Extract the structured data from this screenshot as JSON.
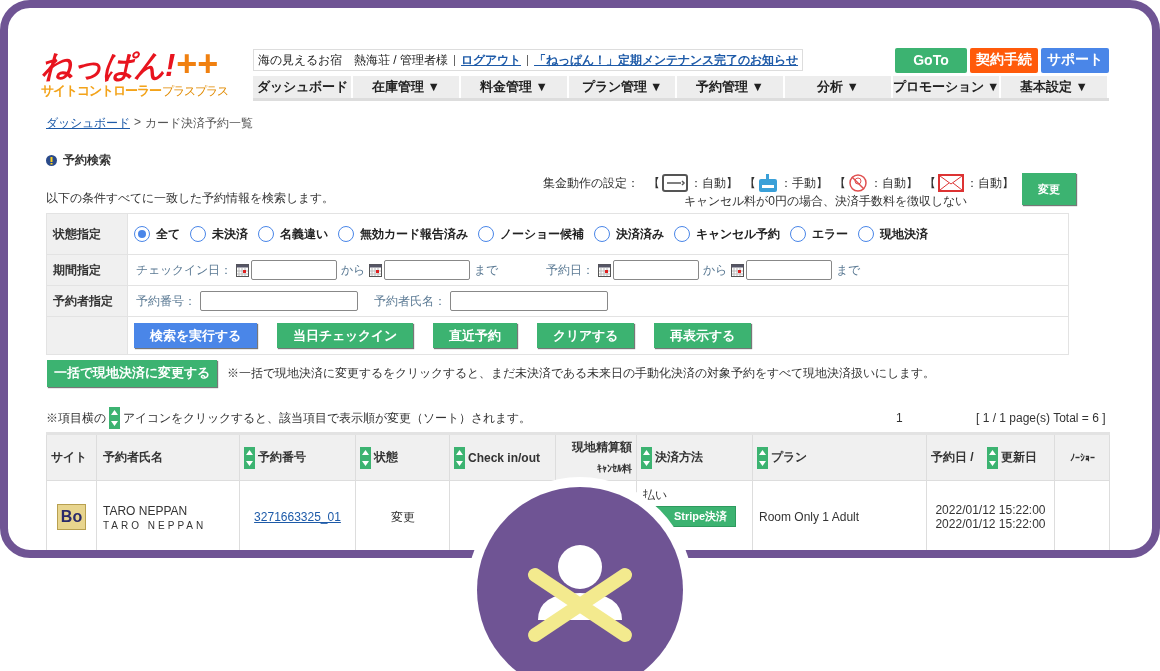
{
  "logo": {
    "main": "ねっぱん!",
    "plus": "++",
    "sub": "サイトコントローラー",
    "sub_small": "プラスプラス"
  },
  "topbar": {
    "hotel": "海の見えるお宿　熱海荘 / 管理者様",
    "links": [
      "ログアウト",
      "「ねっぱん！」定期メンテナンス完了のお知らせ"
    ]
  },
  "top_buttons": [
    {
      "label": "GoTo",
      "color": "#3cb371"
    },
    {
      "label": "契約手続",
      "color": "#ff5a0a"
    },
    {
      "label": "サポート",
      "color": "#4a86e8"
    }
  ],
  "nav": [
    "ダッシュボード",
    "在庫管理 ▼",
    "料金管理 ▼",
    "プラン管理 ▼",
    "予約管理 ▼",
    "分析 ▼",
    "プロモーション ▼",
    "基本設定 ▼"
  ],
  "breadcrumb": {
    "link": "ダッシュボード",
    "separator": ">",
    "current": "カード決済予約一覧"
  },
  "section_title": "予約検索",
  "collection": {
    "label": "集金動作の設定：",
    "items": [
      {
        "kind": "card",
        "open": "【",
        "value": "：自動】"
      },
      {
        "kind": "terminal",
        "open": "【",
        "value": "：手動】"
      },
      {
        "kind": "noshow",
        "open": "【",
        "value": "：自動】"
      },
      {
        "kind": "mail",
        "open": "【",
        "value": "：自動】"
      }
    ],
    "note": "キャンセル料が0円の場合、決済手数料を徴収しない",
    "button": "変更"
  },
  "intro": "以下の条件すべてに一致した予約情報を検索します。",
  "search": {
    "status": {
      "label": "状態指定",
      "options": [
        {
          "label": "全て",
          "selected": true
        },
        {
          "label": "未決済",
          "selected": false
        },
        {
          "label": "名義違い",
          "selected": false
        },
        {
          "label": "無効カード報告済み",
          "selected": false
        },
        {
          "label": "ノーショー候補",
          "selected": false
        },
        {
          "label": "決済済み",
          "selected": false
        },
        {
          "label": "キャンセル予約",
          "selected": false
        },
        {
          "label": "エラー",
          "selected": false
        },
        {
          "label": "現地決済",
          "selected": false
        }
      ]
    },
    "period": {
      "label": "期間指定",
      "groups": [
        {
          "label": "チェックイン日：",
          "from": "から",
          "to": "まで"
        },
        {
          "label": "予約日：",
          "from": "から",
          "to": "まで"
        }
      ]
    },
    "booker": {
      "label": "予約者指定",
      "fields": [
        "予約番号：",
        "予約者氏名："
      ]
    },
    "buttons": [
      {
        "label": "検索を実行する",
        "color": "#4a86e8"
      },
      {
        "label": "当日チェックイン",
        "color": "#3cb371"
      },
      {
        "label": "直近予約",
        "color": "#3cb371"
      },
      {
        "label": "クリアする",
        "color": "#3cb371"
      },
      {
        "label": "再表示する",
        "color": "#3cb371"
      }
    ]
  },
  "bulk": {
    "button": "一括で現地決済に変更する",
    "note": "※一括で現地決済に変更するをクリックすると、まだ未決済である未来日の手動化決済の対象予約をすべて現地決済扱いにします。"
  },
  "sort_note": {
    "before": "※項目横の",
    "after": "アイコンをクリックすると、該当項目で表示順が変更（ソート）されます。"
  },
  "pager": {
    "page": "1",
    "summary": "[ 1 / 1 page(s) Total = 6 ]"
  },
  "table": {
    "columns": [
      {
        "label": "サイト",
        "sortable": false
      },
      {
        "label": "予約者氏名",
        "sortable": false
      },
      {
        "label": "予約番号",
        "sortable": true
      },
      {
        "label": "状態",
        "sortable": true
      },
      {
        "label": "Check in/out",
        "sortable": true
      },
      {
        "label": "現地精算額",
        "sub": "ｷｬﾝｾﾙ料",
        "sortable": false
      },
      {
        "label": "決済方法",
        "sortable": true
      },
      {
        "label": "プラン",
        "sortable": true
      },
      {
        "prefix": "予約日 /",
        "label": "更新日",
        "sortable": true
      },
      {
        "label": "ﾉｰｼｮｰ",
        "sortable": false
      }
    ],
    "rows": [
      {
        "site": "Bo",
        "name": "TARO NEPPAN",
        "name_kana": "TARO NEPPAN",
        "number": "3271663325_01",
        "status": "変更",
        "payment": "払い",
        "payment_badge": "Stripe決済",
        "plan": "Room Only 1 Adult",
        "dates": [
          "2022/01/12 15:22:00",
          "2022/01/12 15:22:00"
        ]
      }
    ]
  }
}
